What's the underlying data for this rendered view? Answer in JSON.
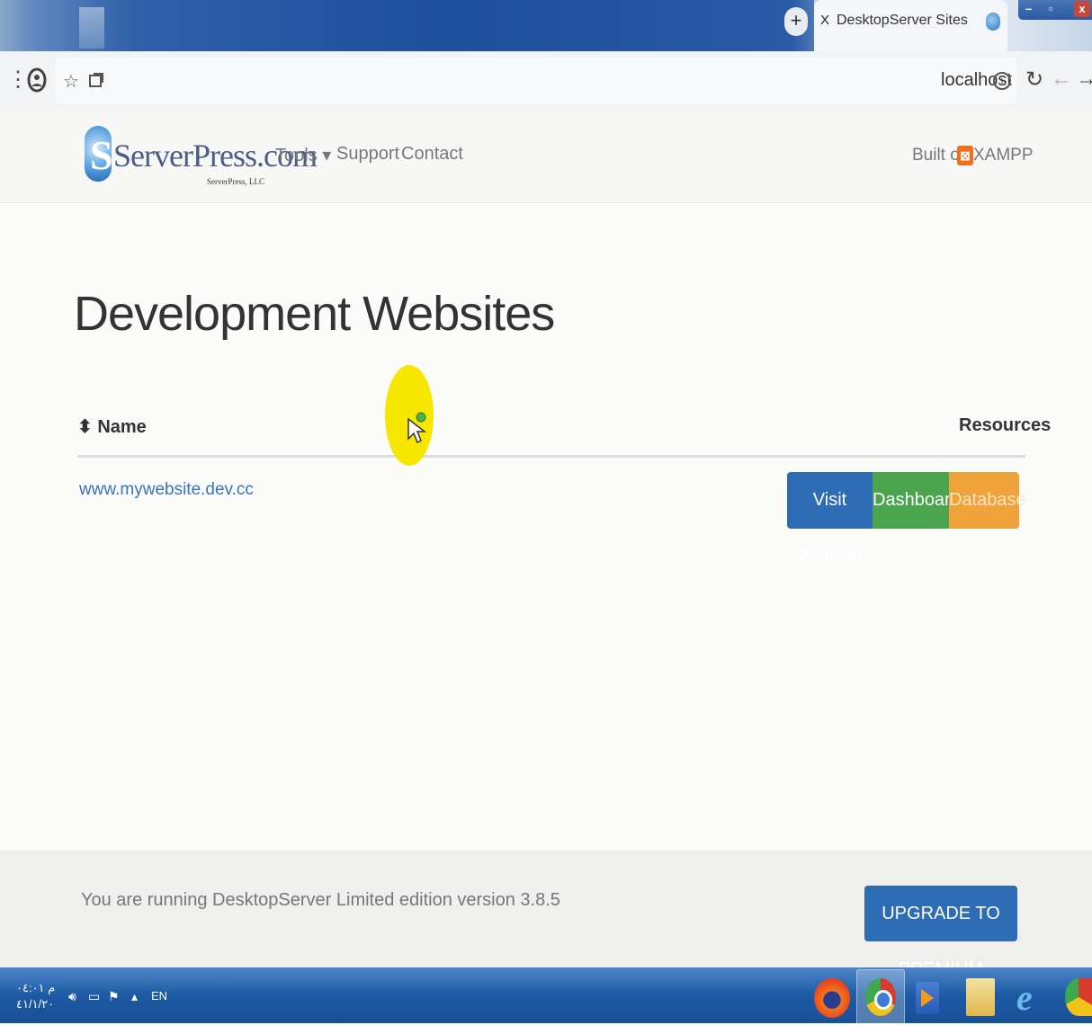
{
  "browser": {
    "new_tab_label": "+",
    "tab_close": "X",
    "tab_title": "DesktopServer Sites",
    "url": "localhost",
    "menu_icon": "⋮",
    "star_icon": "☆",
    "info_icon": "i",
    "reload_icon": "↻",
    "back_icon": "←",
    "forward_icon": "→"
  },
  "site": {
    "logo_text": "ServerPress.com",
    "logo_sub": "ServerPress, LLC",
    "logo_letter": "S",
    "nav": {
      "tools": "Tools ▾",
      "support": "Support",
      "contact": "Contact"
    },
    "built_on": "Built on",
    "xampp_icon": "⊠",
    "xampp": "XAMPP"
  },
  "main": {
    "title": "Development Websites",
    "columns": {
      "name": "⬍ Name",
      "resources": "Resources"
    },
    "rows": [
      {
        "name": "www.mywebsite.dev.cc",
        "visit": "Visit Website",
        "dashboard": "Dashboard",
        "database": "Database"
      }
    ]
  },
  "footer": {
    "text": "You are running DesktopServer Limited edition version 3.8.5",
    "upgrade": "UPGRADE TO PREMIUM"
  },
  "taskbar": {
    "clock_time": "م ٠٤:٠١",
    "clock_date": "٤١/١/٢٠",
    "lang": "EN"
  },
  "colors": {
    "visit": "#2e6db5",
    "dashboard": "#4aa54e",
    "database": "#f0a33b",
    "upgrade": "#2e6db5",
    "highlight": "#f6e600"
  }
}
